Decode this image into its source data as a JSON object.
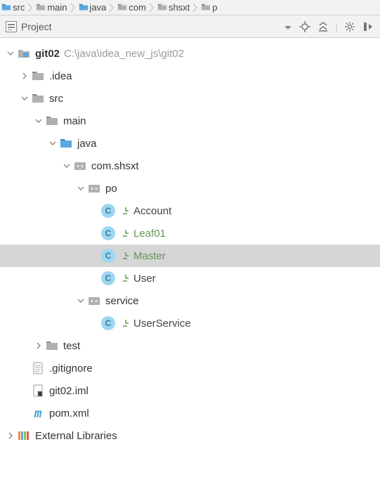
{
  "breadcrumb": {
    "items": [
      "src",
      "main",
      "java",
      "com",
      "shsxt",
      "p"
    ]
  },
  "toolwindow": {
    "title": "Project"
  },
  "tree": {
    "root": {
      "name": "git02",
      "path": "C:\\java\\idea_new_js\\git02"
    },
    "idea_folder": ".idea",
    "src": "src",
    "main": "main",
    "java": "java",
    "package": "com.shsxt",
    "po": "po",
    "po_classes": {
      "account": "Account",
      "leaf01": "Leaf01",
      "master": "Master",
      "user": "User"
    },
    "service": "service",
    "service_classes": {
      "userservice": "UserService"
    },
    "test": "test",
    "gitignore": ".gitignore",
    "iml": "git02.iml",
    "pom": "pom.xml",
    "ext_lib": "External Libraries"
  }
}
